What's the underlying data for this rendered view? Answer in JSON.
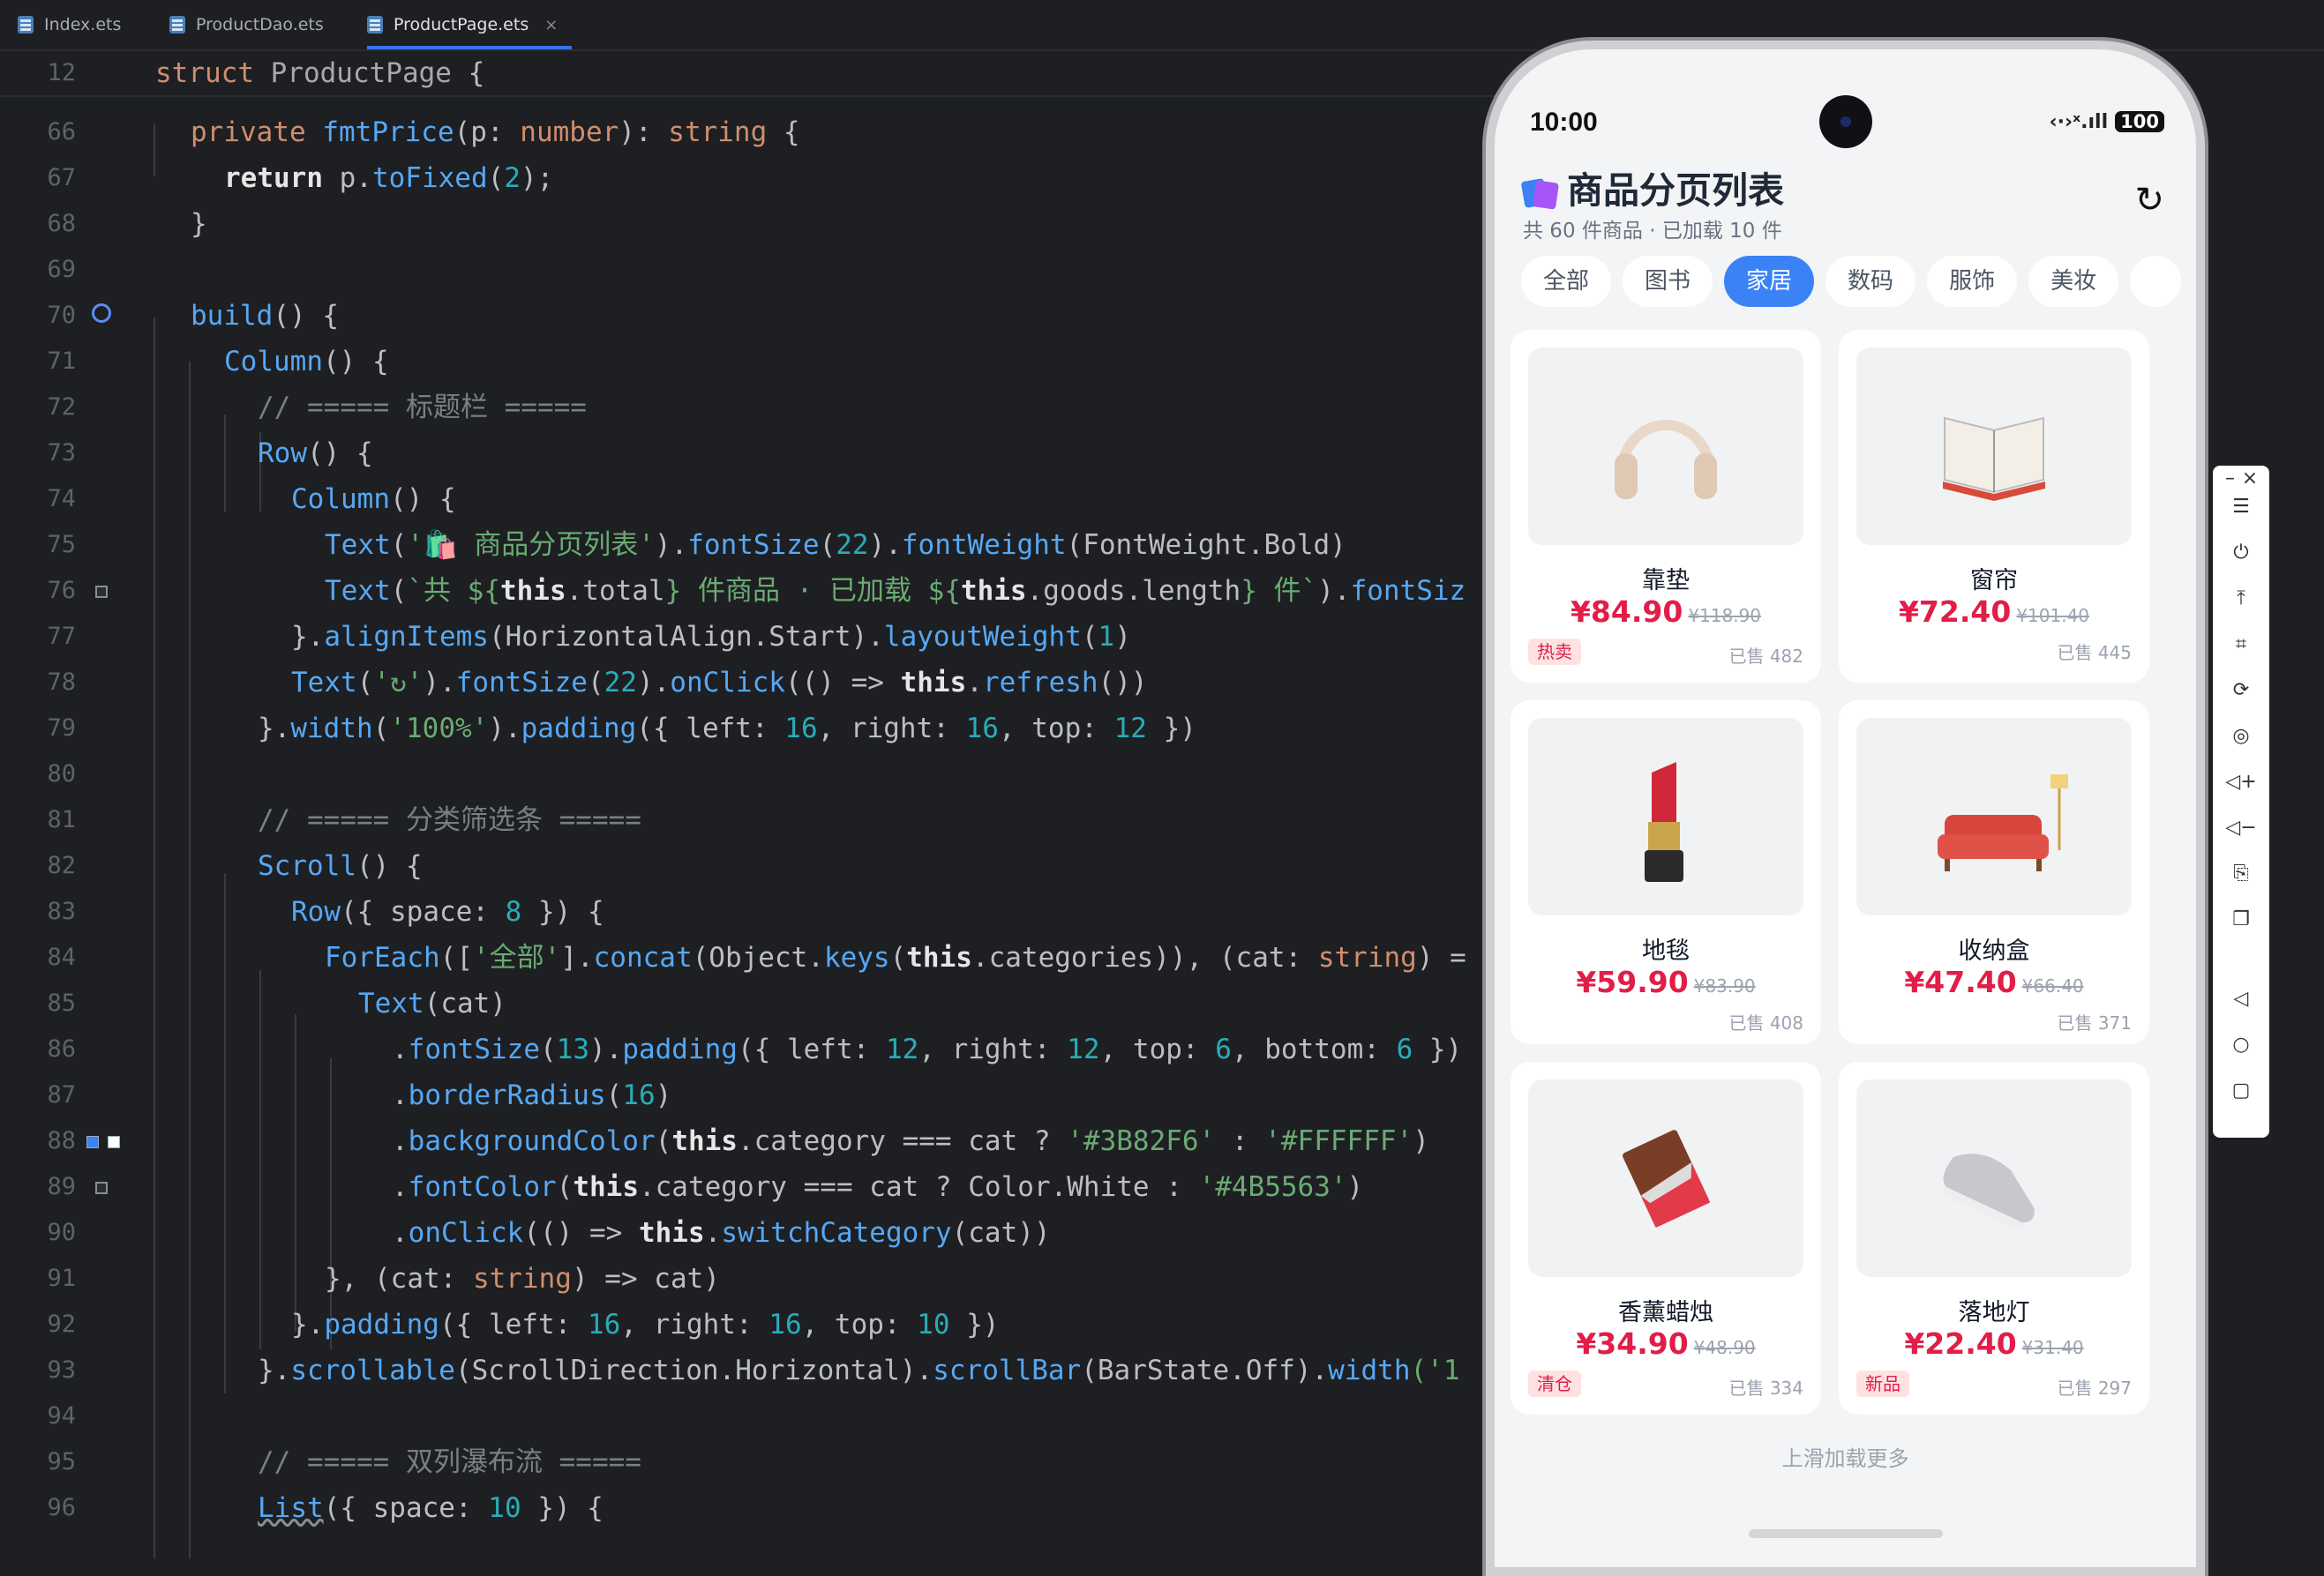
{
  "tabs": [
    {
      "label": "Index.ets",
      "active": false
    },
    {
      "label": "ProductDao.ets",
      "active": false
    },
    {
      "label": "ProductPage.ets",
      "active": true
    }
  ],
  "sticky": {
    "line": "12",
    "code_kw": "struct",
    "code_name": "ProductPage",
    "code_rest": " {"
  },
  "lines": {
    "l66": "66",
    "l67": "67",
    "l68": "68",
    "l69": "69",
    "l70": "70",
    "l71": "71",
    "l72": "72",
    "l73": "73",
    "l74": "74",
    "l75": "75",
    "l76": "76",
    "l77": "77",
    "l78": "78",
    "l79": "79",
    "l80": "80",
    "l81": "81",
    "l82": "82",
    "l83": "83",
    "l84": "84",
    "l85": "85",
    "l86": "86",
    "l87": "87",
    "l88": "88",
    "l89": "89",
    "l90": "90",
    "l91": "91",
    "l92": "92",
    "l93": "93",
    "l94": "94",
    "l95": "95",
    "l96": "96"
  },
  "code": {
    "c66a": "private",
    "c66b": "fmtPrice",
    "c66c": "(p: ",
    "c66d": "number",
    "c66e": "): ",
    "c66f": "string",
    "c66g": " {",
    "c67a": "return",
    "c67b": " p.",
    "c67c": "toFixed",
    "c67d": "(",
    "c67e": "2",
    "c67f": ");",
    "c68": "}",
    "c70a": "build",
    "c70b": "() {",
    "c71a": "Column",
    "c71b": "() {",
    "c72": "// ===== 标题栏 =====",
    "c73a": "Row",
    "c73b": "() {",
    "c74a": "Column",
    "c74b": "() {",
    "c75a": "Text",
    "c75b": "(",
    "c75c": "'🛍️ 商品分页列表'",
    "c75d": ").",
    "c75e": "fontSize",
    "c75f": "(",
    "c75g": "22",
    "c75h": ").",
    "c75i": "fontWeight",
    "c75j": "(FontWeight.Bold)",
    "c76a": "Text",
    "c76b": "(",
    "c76c": "`共 ${",
    "c76d": "this",
    "c76e": ".total",
    "c76f": "} 件商品 · 已加载 ${",
    "c76g": "this",
    "c76h": ".goods.length",
    "c76i": "} 件`",
    "c76j": ").",
    "c76k": "fontSiz",
    "c77a": "}.",
    "c77b": "alignItems",
    "c77c": "(HorizontalAlign.Start).",
    "c77d": "layoutWeight",
    "c77e": "(",
    "c77f": "1",
    "c77g": ")",
    "c78a": "Text",
    "c78b": "(",
    "c78c": "'↻'",
    "c78d": ").",
    "c78e": "fontSize",
    "c78f": "(",
    "c78g": "22",
    "c78h": ").",
    "c78i": "onClick",
    "c78j": "(() => ",
    "c78k": "this",
    "c78l": ".",
    "c78m": "refresh",
    "c78n": "())",
    "c79a": "}.",
    "c79b": "width",
    "c79c": "(",
    "c79d": "'100%'",
    "c79e": ").",
    "c79f": "padding",
    "c79g": "({ left: ",
    "c79h": "16",
    "c79i": ", right: ",
    "c79j": "16",
    "c79k": ", top: ",
    "c79l": "12",
    "c79m": " })",
    "c81": "// ===== 分类筛选条 =====",
    "c82a": "Scroll",
    "c82b": "() {",
    "c83a": "Row",
    "c83b": "({ space: ",
    "c83c": "8",
    "c83d": " }) {",
    "c84a": "ForEach",
    "c84b": "([",
    "c84c": "'全部'",
    "c84d": "].",
    "c84e": "concat",
    "c84f": "(Object.",
    "c84g": "keys",
    "c84h": "(",
    "c84i": "this",
    "c84j": ".categories)), (cat: ",
    "c84k": "string",
    "c84l": ") =",
    "c85a": "Text",
    "c85b": "(cat)",
    "c86a": ".",
    "c86b": "fontSize",
    "c86c": "(",
    "c86d": "13",
    "c86e": ").",
    "c86f": "padding",
    "c86g": "({ left: ",
    "c86h": "12",
    "c86i": ", right: ",
    "c86j": "12",
    "c86k": ", top: ",
    "c86l": "6",
    "c86m": ", bottom: ",
    "c86n": "6",
    "c86o": " })",
    "c87a": ".",
    "c87b": "borderRadius",
    "c87c": "(",
    "c87d": "16",
    "c87e": ")",
    "c88a": ".",
    "c88b": "backgroundColor",
    "c88c": "(",
    "c88d": "this",
    "c88e": ".category === cat ? ",
    "c88f": "'#3B82F6'",
    "c88g": " : ",
    "c88h": "'#FFFFFF'",
    "c88i": ")",
    "c89a": ".",
    "c89b": "fontColor",
    "c89c": "(",
    "c89d": "this",
    "c89e": ".category === cat ? Color.White : ",
    "c89f": "'#4B5563'",
    "c89g": ")",
    "c90a": ".",
    "c90b": "onClick",
    "c90c": "(() => ",
    "c90d": "this",
    "c90e": ".",
    "c90f": "switchCategory",
    "c90g": "(cat))",
    "c91a": "}, (cat: ",
    "c91b": "string",
    "c91c": ") => cat)",
    "c92a": "}.",
    "c92b": "padding",
    "c92c": "({ left: ",
    "c92d": "16",
    "c92e": ", right: ",
    "c92f": "16",
    "c92g": ", top: ",
    "c92h": "10",
    "c92i": " })",
    "c93a": "}.",
    "c93b": "scrollable",
    "c93c": "(ScrollDirection.Horizontal).",
    "c93d": "scrollBar",
    "c93e": "(BarState.Off).",
    "c93f": "width",
    "c93g": "('1",
    "c95": "// ===== 双列瀑布流 =====",
    "c96a": "List",
    "c96b": "({ space: ",
    "c96c": "10",
    "c96d": " }) {"
  },
  "phone": {
    "time": "10:00",
    "signal": "‹·›ˣ.ıll",
    "battery": "100",
    "title": "商品分页列表",
    "subtitle": "共 60 件商品 · 已加载 10 件",
    "refresh_icon": "↻",
    "categories": [
      "全部",
      "图书",
      "家居",
      "数码",
      "服饰",
      "美妆"
    ],
    "active_category": "家居",
    "products": [
      {
        "name": "靠垫",
        "price": "¥84.90",
        "orig": "¥118.90",
        "tag": "热卖",
        "sold": "已售 482",
        "icon": "headphones"
      },
      {
        "name": "窗帘",
        "price": "¥72.40",
        "orig": "¥101.40",
        "tag": "",
        "sold": "已售 445",
        "icon": "book"
      },
      {
        "name": "地毯",
        "price": "¥59.90",
        "orig": "¥83.90",
        "tag": "",
        "sold": "已售 408",
        "icon": "lipstick"
      },
      {
        "name": "收纳盒",
        "price": "¥47.40",
        "orig": "¥66.40",
        "tag": "",
        "sold": "已售 371",
        "icon": "sofa"
      },
      {
        "name": "香薰蜡烛",
        "price": "¥34.90",
        "orig": "¥48.90",
        "tag": "清仓",
        "sold": "已售 334",
        "icon": "chocolate"
      },
      {
        "name": "落地灯",
        "price": "¥22.40",
        "orig": "¥31.40",
        "tag": "新品",
        "sold": "已售 297",
        "icon": "sneaker"
      }
    ],
    "load_more": "上滑加载更多"
  },
  "colors": {
    "accent": "#3B82F6",
    "price": "#E11D48",
    "ide_bg": "#1E1F22"
  }
}
